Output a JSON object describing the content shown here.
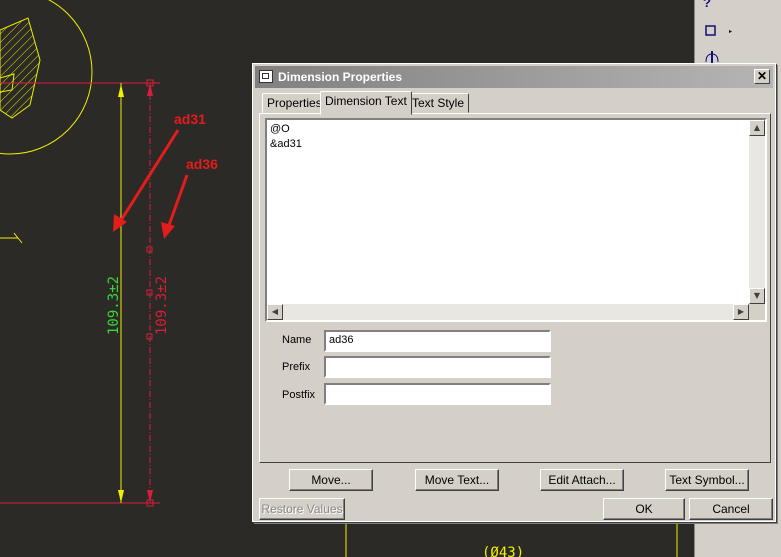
{
  "dialog": {
    "title": "Dimension Properties",
    "close_glyph": "✕",
    "tabs": [
      {
        "label": "Properties",
        "active": false
      },
      {
        "label": "Dimension Text",
        "active": true
      },
      {
        "label": "Text Style",
        "active": false
      }
    ],
    "text_lines": [
      "@O",
      "&ad31"
    ],
    "fields": {
      "name_label": "Name",
      "name_value": "ad36",
      "prefix_label": "Prefix",
      "prefix_value": "",
      "postfix_label": "Postfix",
      "postfix_value": ""
    },
    "buttons": {
      "move": "Move...",
      "move_text": "Move Text...",
      "edit_attach": "Edit Attach...",
      "text_symbol": "Text Symbol...",
      "restore_values": "Restore Values",
      "ok": "OK",
      "cancel": "Cancel"
    }
  },
  "drawing": {
    "dim_green": "109.3±2",
    "dim_red": "109.3±2",
    "annotation_ad31": "ad31",
    "annotation_ad36": "ad36",
    "bottom_label": "(Ø43)",
    "colors": {
      "background": "#2b2a26",
      "yellow": "#f0f000",
      "red": "#d81e3c",
      "green": "#3ad63a",
      "annotation": "#e41c1c"
    }
  },
  "toolbar": {
    "icons": [
      "help-icon",
      "rectangle-flyout-icon",
      "datum-axis-icon"
    ]
  }
}
